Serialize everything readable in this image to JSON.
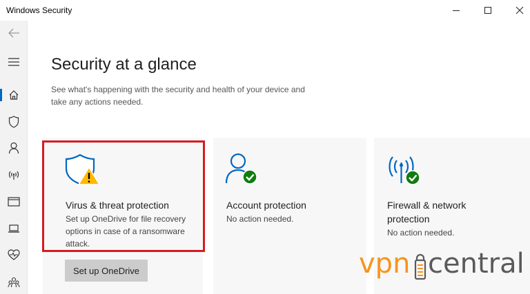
{
  "window": {
    "title": "Windows Security",
    "controls": {
      "minimize": "minimize-icon",
      "maximize": "maximize-icon",
      "close": "close-icon"
    }
  },
  "sidebar": {
    "items": [
      {
        "id": "back",
        "icon": "back-arrow-icon"
      },
      {
        "id": "menu",
        "icon": "hamburger-menu-icon"
      },
      {
        "id": "home",
        "icon": "home-icon",
        "active": true
      },
      {
        "id": "virus-threat",
        "icon": "shield-icon"
      },
      {
        "id": "account",
        "icon": "person-icon"
      },
      {
        "id": "firewall",
        "icon": "antenna-icon"
      },
      {
        "id": "app-browser",
        "icon": "browser-window-icon"
      },
      {
        "id": "device-security",
        "icon": "laptop-icon"
      },
      {
        "id": "device-health",
        "icon": "heart-pulse-icon"
      },
      {
        "id": "family",
        "icon": "family-icon"
      }
    ],
    "accent": "#0067c0"
  },
  "main": {
    "title": "Security at a glance",
    "description": "See what's happening with the security and health of your device and take any actions needed."
  },
  "cards": [
    {
      "id": "virus",
      "icon": "shield-warning-icon",
      "title": "Virus & threat protection",
      "status": "Set up OneDrive for file recovery options in case of a ransomware attack.",
      "button": "Set up OneDrive",
      "status_level": "warning"
    },
    {
      "id": "account",
      "icon": "account-ok-icon",
      "title": "Account protection",
      "status": "No action needed.",
      "status_level": "ok"
    },
    {
      "id": "firewall",
      "icon": "firewall-ok-icon",
      "title": "Firewall & network protection",
      "title_lines": [
        "Firewall & network",
        "protection"
      ],
      "status": "No action needed.",
      "status_level": "ok"
    }
  ],
  "colors": {
    "accent_blue": "#0067c0",
    "ok_green": "#107c10",
    "warning_yellow": "#ffb900",
    "highlight_red": "#d71920"
  },
  "watermark": {
    "text_left": "vpn",
    "text_right": "central",
    "color_orange": "#f7941d",
    "color_gray": "#5a5a5a"
  }
}
